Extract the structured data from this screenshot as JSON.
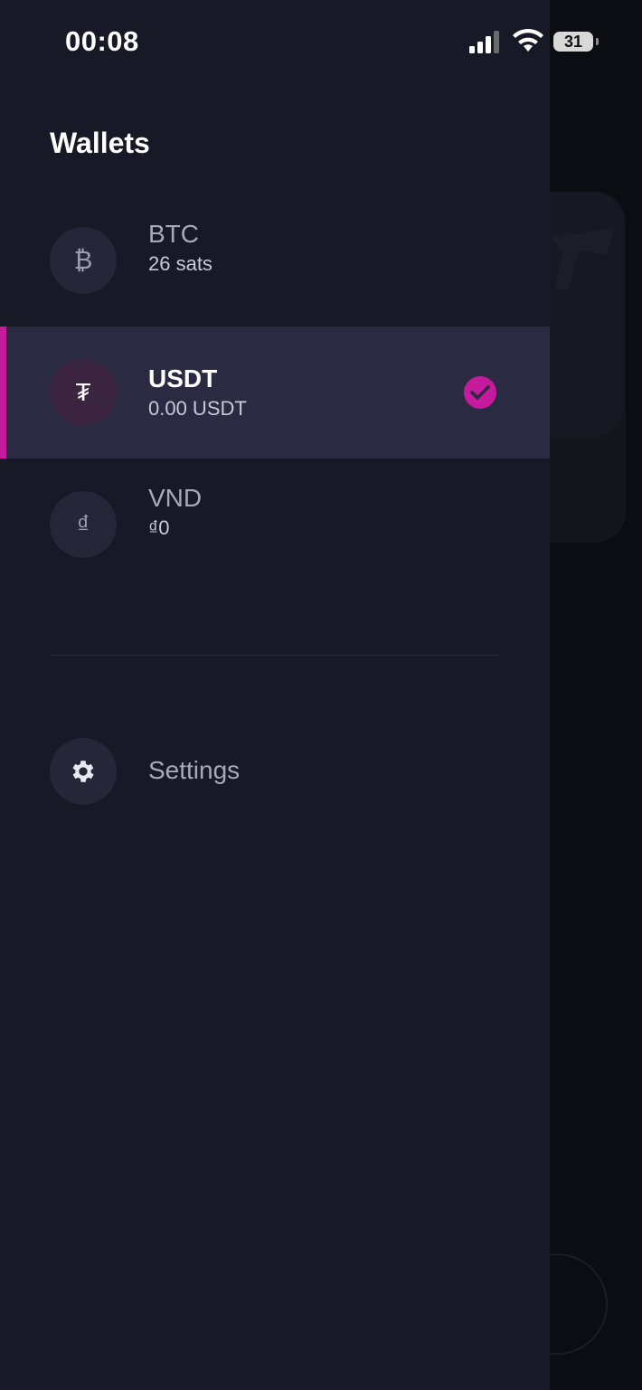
{
  "status_bar": {
    "time": "00:08",
    "battery": "31"
  },
  "drawer": {
    "title": "Wallets",
    "wallets": [
      {
        "name": "BTC",
        "balance": "26 sats",
        "icon": "bitcoin-icon",
        "glyph": "₿",
        "selected": false
      },
      {
        "name": "USDT",
        "balance": "0.00 USDT",
        "icon": "tether-icon",
        "glyph": "₮",
        "selected": true
      },
      {
        "name": "VND",
        "balance": "₫0",
        "icon": "dong-icon",
        "glyph": "₫",
        "selected": false
      }
    ],
    "settings_label": "Settings"
  },
  "colors": {
    "accent": "#c51a9b",
    "drawer_bg": "#171926",
    "selected_row": "#2a2b42"
  }
}
